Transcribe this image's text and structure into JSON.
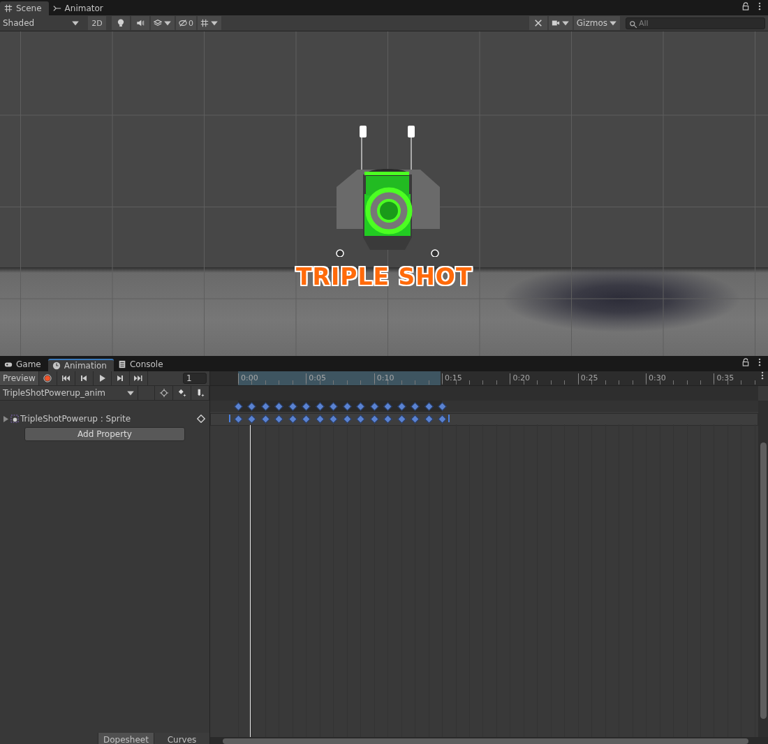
{
  "top_tabs": [
    {
      "label": "Scene",
      "selected": true
    },
    {
      "label": "Animator",
      "selected": false
    }
  ],
  "scene_toolbar": {
    "shading": "Shaded",
    "mode_2d": "2D",
    "hidden_count": "0",
    "gizmos": "Gizmos",
    "search_placeholder": "All"
  },
  "scene": {
    "sprite_text": "TRIPLE SHOT"
  },
  "bottom_tabs": [
    {
      "label": "Game",
      "selected": false
    },
    {
      "label": "Animation",
      "selected": true
    },
    {
      "label": "Console",
      "selected": false
    }
  ],
  "animation": {
    "preview": "Preview",
    "frame": "1",
    "clip": "TripleShotPowerup_anim",
    "properties": [
      {
        "name": "TripleShotPowerup : Sprite",
        "expanded": false
      }
    ],
    "add_property": "Add Property",
    "ruler": [
      "0:00",
      "0:05",
      "0:10",
      "0:15",
      "0:20",
      "0:25",
      "0:30",
      "0:35"
    ],
    "view_tabs": [
      {
        "label": "Dopesheet",
        "selected": true
      },
      {
        "label": "Curves",
        "selected": false
      }
    ]
  }
}
